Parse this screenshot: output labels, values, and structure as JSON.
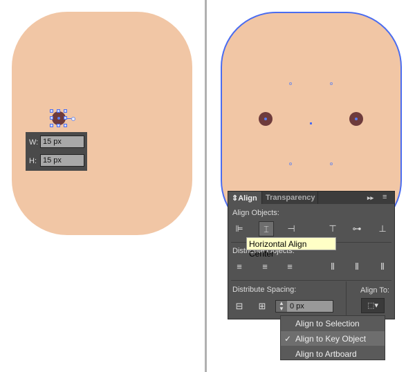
{
  "left": {
    "width_label": "W:",
    "width_value": "15 px",
    "height_label": "H:",
    "height_value": "15 px"
  },
  "panel": {
    "tabs": [
      {
        "label": "Align",
        "icon": "updown-arrows-icon"
      },
      {
        "label": "Transparency"
      }
    ],
    "align_objects": "Align Objects:",
    "distribute_objects": "Distribute Objects:",
    "distribute_spacing": "Distribute Spacing:",
    "align_to": "Align To:",
    "spacing_value": "0 px"
  },
  "tooltip": "Horizontal Align Center",
  "menu": {
    "items": [
      {
        "label": "Align to Selection",
        "checked": false
      },
      {
        "label": "Align to Key Object",
        "checked": true,
        "check": "✓"
      },
      {
        "label": "Align to Artboard",
        "checked": false
      }
    ]
  },
  "colors": {
    "face": "#f1c6a5",
    "eye": "#6e3b3c",
    "selection": "#4a6cf0"
  }
}
